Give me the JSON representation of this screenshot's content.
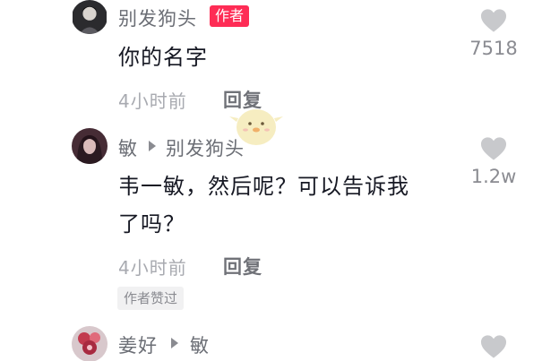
{
  "comments": [
    {
      "username": "别发狗头",
      "badge": "作者",
      "text": "你的名字",
      "time": "4小时前",
      "reply_label": "回复",
      "like_count": "7518"
    },
    {
      "username": "敏",
      "reply_to": "别发狗头",
      "text_line1": "韦一敏，然后呢？可以告诉我",
      "text_line2": "了吗？",
      "time": "4小时前",
      "reply_label": "回复",
      "liked_by_author": "作者赞过",
      "like_count": "1.2w"
    },
    {
      "username": "姜好",
      "reply_to": "敏"
    }
  ],
  "colors": {
    "accent": "#fe2c55",
    "muted_text": "#a8aab0",
    "heart": "#c8c9cc"
  },
  "icons": [
    "heart-icon",
    "reply-arrow-icon",
    "avatar-image"
  ]
}
